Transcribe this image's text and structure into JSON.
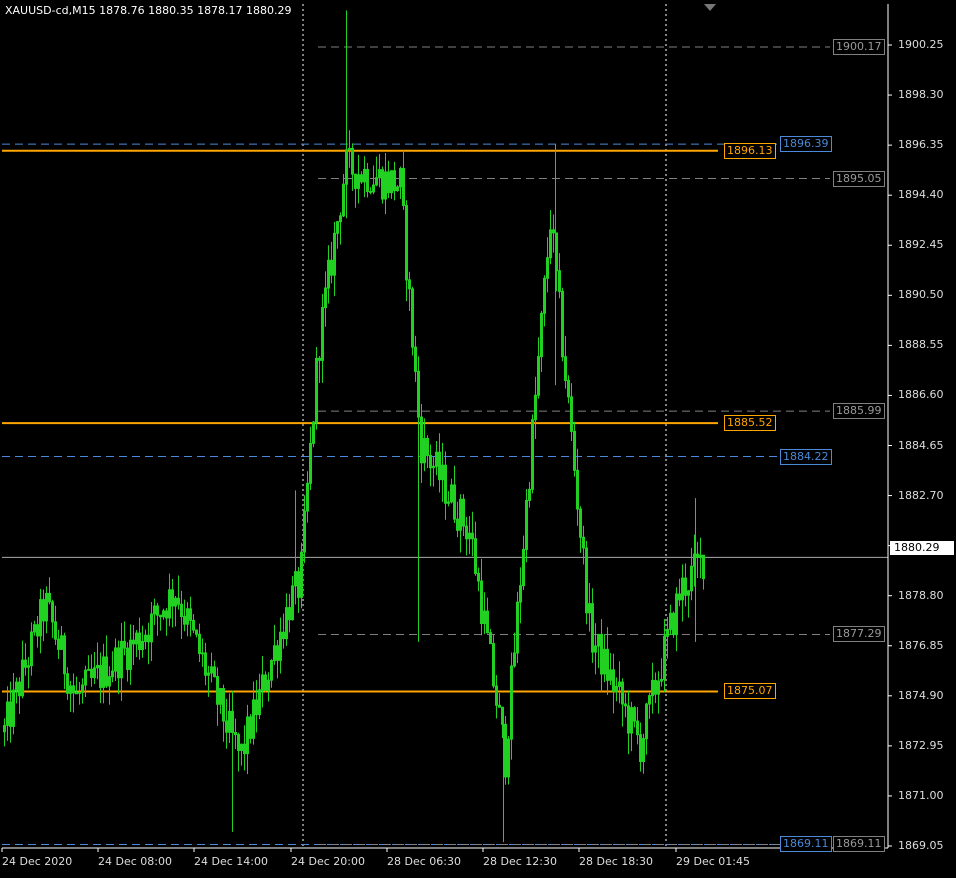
{
  "window": {
    "symbol_line": "XAUUSD-cd,M15  1878.76 1880.35 1878.17 1880.29"
  },
  "colors": {
    "background": "#000000",
    "candle": "#22d022",
    "axis": "#ffffff",
    "orange_level": "#ffa500",
    "blue_level": "#4a8ad8",
    "gray_level": "#808080",
    "separator": "#ffffff"
  },
  "price_axis": {
    "ticks": [
      "1900.25",
      "1898.30",
      "1896.35",
      "1894.40",
      "1892.45",
      "1890.50",
      "1888.55",
      "1886.60",
      "1884.65",
      "1882.70",
      "1880.75",
      "1878.80",
      "1876.85",
      "1874.90",
      "1872.95",
      "1871.00",
      "1869.05"
    ],
    "current_price": "1880.29"
  },
  "time_axis": {
    "ticks": [
      "24 Dec 2020",
      "24 Dec 08:00",
      "24 Dec 14:00",
      "24 Dec 20:00",
      "28 Dec 06:30",
      "28 Dec 12:30",
      "28 Dec 18:30",
      "29 Dec 01:45"
    ]
  },
  "levels": [
    {
      "price": 1900.17,
      "label": "1900.17",
      "kind": "gray"
    },
    {
      "price": 1896.39,
      "label": "1896.39",
      "kind": "blue"
    },
    {
      "price": 1896.13,
      "label": "1896.13",
      "kind": "orange"
    },
    {
      "price": 1895.05,
      "label": "1895.05",
      "kind": "gray"
    },
    {
      "price": 1885.99,
      "label": "1885.99",
      "kind": "gray"
    },
    {
      "price": 1885.52,
      "label": "1885.52",
      "kind": "orange"
    },
    {
      "price": 1884.22,
      "label": "1884.22",
      "kind": "blue"
    },
    {
      "price": 1877.29,
      "label": "1877.29",
      "kind": "gray"
    },
    {
      "price": 1875.07,
      "label": "1875.07",
      "kind": "orange"
    },
    {
      "price": 1869.11,
      "label": "1869.11",
      "kind": "blue"
    },
    {
      "price": 1869.11,
      "label": "1869.11",
      "kind": "gray"
    }
  ],
  "chart_data": {
    "type": "line",
    "title": "XAUUSD-cd,M15",
    "ylim": [
      1868.5,
      1902.1
    ],
    "x": [
      "24 Dec 2020",
      "24 Dec 08:00",
      "24 Dec 14:00",
      "24 Dec 20:00",
      "28 Dec 06:30",
      "28 Dec 12:30",
      "28 Dec 18:30",
      "29 Dec 01:45"
    ],
    "series": [
      {
        "values": [
          1873.5,
          1878.5,
          1874.8,
          1877.2,
          1879.0,
          1873.2,
          1872.5,
          1878.6,
          1879.3,
          1888.5,
          1895.5,
          1894.8,
          1884.8,
          1881.2,
          1872.5,
          1893.5,
          1877.3,
          1873.0,
          1879.0,
          1880.3
        ]
      }
    ],
    "ohlc_last": {
      "open": 1878.76,
      "high": 1880.35,
      "low": 1878.17,
      "close": 1880.29
    }
  }
}
